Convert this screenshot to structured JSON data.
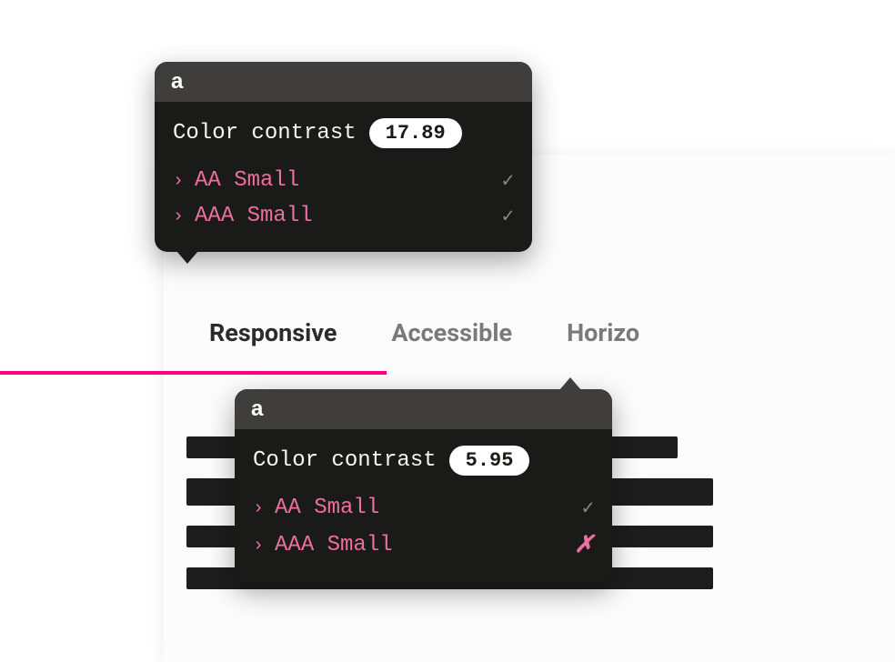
{
  "tabs": {
    "items": [
      {
        "label": "Responsive",
        "active": true
      },
      {
        "label": "Accessible",
        "active": false
      },
      {
        "label": "Horizo",
        "active": false
      }
    ]
  },
  "tooltips": [
    {
      "header_letter": "a",
      "title": "Color contrast",
      "ratio": "17.89",
      "criteria": [
        {
          "caret": "›",
          "label": "AA Small",
          "status": "pass"
        },
        {
          "caret": "›",
          "label": "AAA Small",
          "status": "pass"
        }
      ]
    },
    {
      "header_letter": "a",
      "title": "Color contrast",
      "ratio": "5.95",
      "criteria": [
        {
          "caret": "›",
          "label": "AA Small",
          "status": "pass"
        },
        {
          "caret": "›",
          "label": "AAA Small",
          "status": "fail"
        }
      ]
    }
  ],
  "icons": {
    "pass": "✓",
    "fail": "✗"
  },
  "colors": {
    "accent": "#ff0080",
    "criteria": "#ed6ea0",
    "tooltip_bg": "#1a1a18",
    "tooltip_header": "#3f3e3c"
  }
}
